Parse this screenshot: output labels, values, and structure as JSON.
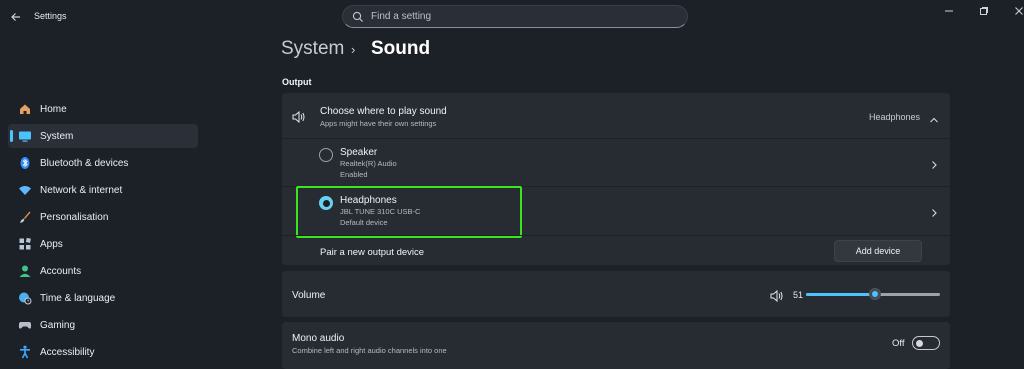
{
  "window": {
    "title": "Settings",
    "back_icon": "arrow-left-icon",
    "controls": [
      "minimize-icon",
      "restore-icon",
      "close-icon"
    ]
  },
  "search": {
    "placeholder": "Find a setting",
    "icon": "search-icon"
  },
  "sidebar": {
    "items": [
      {
        "label": "Home",
        "icon": "home-icon",
        "color": "#e8a060",
        "selected": false
      },
      {
        "label": "System",
        "icon": "display-icon",
        "color": "#4cc2ff",
        "selected": true
      },
      {
        "label": "Bluetooth & devices",
        "icon": "bluetooth-icon",
        "color": "#2f8fff",
        "selected": false
      },
      {
        "label": "Network & internet",
        "icon": "wifi-icon",
        "color": "#5fb8ff",
        "selected": false
      },
      {
        "label": "Personalisation",
        "icon": "brush-icon",
        "color": "#e0904a",
        "selected": false
      },
      {
        "label": "Apps",
        "icon": "apps-icon",
        "color": "#b9c6d6",
        "selected": false
      },
      {
        "label": "Accounts",
        "icon": "person-icon",
        "color": "#3fc58a",
        "selected": false
      },
      {
        "label": "Time & language",
        "icon": "globe-clock-icon",
        "color": "#4ab0f0",
        "selected": false
      },
      {
        "label": "Gaming",
        "icon": "gamepad-icon",
        "color": "#b8bec8",
        "selected": false
      },
      {
        "label": "Accessibility",
        "icon": "accessibility-icon",
        "color": "#3fa8ff",
        "selected": false
      }
    ]
  },
  "breadcrumb": {
    "parent": "System",
    "separator": "›",
    "current": "Sound"
  },
  "output": {
    "section_title": "Output",
    "choose": {
      "title": "Choose where to play sound",
      "subtitle": "Apps might have their own settings",
      "value": "Headphones",
      "icon": "speaker-icon",
      "expanded": true
    },
    "devices": [
      {
        "name": "Speaker",
        "detail": "Realtek(R) Audio",
        "status": "Enabled",
        "selected": false
      },
      {
        "name": "Headphones",
        "detail": "JBL TUNE 310C USB-C",
        "status": "Default device",
        "selected": true
      }
    ],
    "pair": {
      "label": "Pair a new output device",
      "button": "Add device"
    }
  },
  "volume": {
    "label": "Volume",
    "value": "51",
    "level": 51,
    "icon": "speaker-icon"
  },
  "mono": {
    "title": "Mono audio",
    "subtitle": "Combine left and right audio channels into one",
    "state_label": "Off",
    "on": false
  },
  "colors": {
    "accent": "#4cc2ff",
    "highlight": "#39e61e",
    "background": "#1c2027",
    "card": "#272b32"
  }
}
